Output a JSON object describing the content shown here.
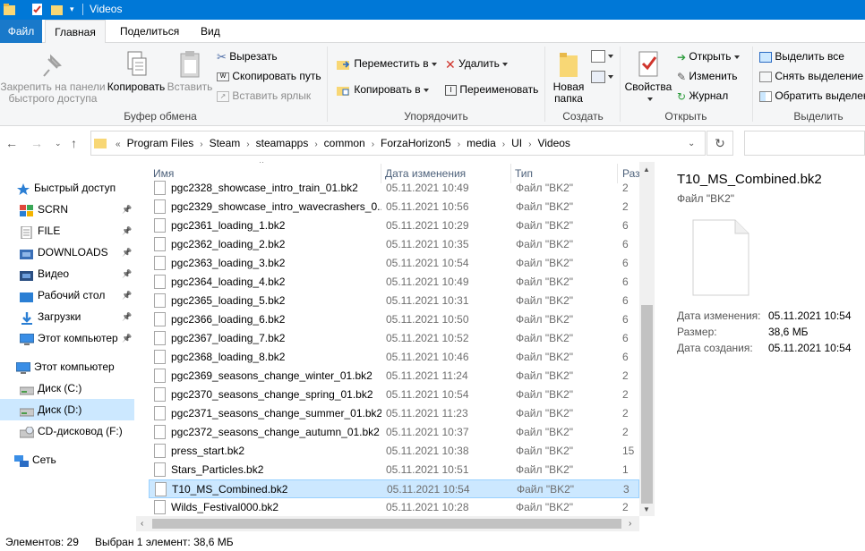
{
  "window": {
    "title": "Videos"
  },
  "ribbon_tabs": {
    "file": "Файл",
    "home": "Главная",
    "share": "Поделиться",
    "view": "Вид"
  },
  "ribbon": {
    "clipboard": {
      "label": "Буфер обмена",
      "pin": "Закрепить на панели быстрого доступа",
      "copy": "Копировать",
      "paste": "Вставить",
      "cut": "Вырезать",
      "copy_path": "Скопировать путь",
      "paste_shortcut": "Вставить ярлык"
    },
    "organize": {
      "label": "Упорядочить",
      "move_to": "Переместить в",
      "copy_to": "Копировать в",
      "delete": "Удалить",
      "rename": "Переименовать"
    },
    "create": {
      "label": "Создать",
      "new_folder": "Новая папка"
    },
    "open": {
      "label": "Открыть",
      "properties": "Свойства",
      "open": "Открыть",
      "edit": "Изменить",
      "history": "Журнал"
    },
    "select": {
      "label": "Выделить",
      "select_all": "Выделить все",
      "select_none": "Снять выделение",
      "invert": "Обратить выделен"
    }
  },
  "address": {
    "prefix": "«",
    "crumbs": [
      "Program Files",
      "Steam",
      "steamapps",
      "common",
      "ForzaHorizon5",
      "media",
      "UI",
      "Videos"
    ]
  },
  "nav_pane": {
    "items": [
      {
        "label": "Быстрый доступ",
        "icon": "star-icon"
      },
      {
        "label": "SCRN",
        "icon": "photos-app-icon",
        "pinned": true
      },
      {
        "label": "FILE",
        "icon": "file-folder-icon",
        "pinned": true
      },
      {
        "label": "DOWNLOADS",
        "icon": "download-folder-icon",
        "pinned": true
      },
      {
        "label": "Видео",
        "icon": "video-folder-icon",
        "pinned": true
      },
      {
        "label": "Рабочий стол",
        "icon": "desktop-folder-icon",
        "pinned": true
      },
      {
        "label": "Загрузки",
        "icon": "downloads-arrow-icon",
        "pinned": true
      },
      {
        "label": "Этот компьютер",
        "icon": "monitor-icon",
        "pinned": true
      },
      {
        "label": "Этот компьютер",
        "icon": "monitor-icon"
      },
      {
        "label": "Диск (C:)",
        "icon": "drive-icon"
      },
      {
        "label": "Диск (D:)",
        "icon": "drive-icon",
        "selected": true
      },
      {
        "label": "CD-дисковод (F:)",
        "icon": "cd-drive-icon"
      },
      {
        "label": "Сеть",
        "icon": "network-icon"
      }
    ]
  },
  "file_list": {
    "columns": {
      "name": "Имя",
      "date": "Дата изменения",
      "type": "Тип",
      "size": "Раз"
    },
    "rows": [
      {
        "name": "pgc2328_showcase_intro_train_01.bk2",
        "date": "05.11.2021 10:49",
        "type": "Файл \"BK2\"",
        "size": "2"
      },
      {
        "name": "pgc2329_showcase_intro_wavecrashers_0...",
        "date": "05.11.2021 10:56",
        "type": "Файл \"BK2\"",
        "size": "2"
      },
      {
        "name": "pgc2361_loading_1.bk2",
        "date": "05.11.2021 10:29",
        "type": "Файл \"BK2\"",
        "size": "6"
      },
      {
        "name": "pgc2362_loading_2.bk2",
        "date": "05.11.2021 10:35",
        "type": "Файл \"BK2\"",
        "size": "6"
      },
      {
        "name": "pgc2363_loading_3.bk2",
        "date": "05.11.2021 10:54",
        "type": "Файл \"BK2\"",
        "size": "6"
      },
      {
        "name": "pgc2364_loading_4.bk2",
        "date": "05.11.2021 10:49",
        "type": "Файл \"BK2\"",
        "size": "6"
      },
      {
        "name": "pgc2365_loading_5.bk2",
        "date": "05.11.2021 10:31",
        "type": "Файл \"BK2\"",
        "size": "6"
      },
      {
        "name": "pgc2366_loading_6.bk2",
        "date": "05.11.2021 10:50",
        "type": "Файл \"BK2\"",
        "size": "6"
      },
      {
        "name": "pgc2367_loading_7.bk2",
        "date": "05.11.2021 10:52",
        "type": "Файл \"BK2\"",
        "size": "6"
      },
      {
        "name": "pgc2368_loading_8.bk2",
        "date": "05.11.2021 10:46",
        "type": "Файл \"BK2\"",
        "size": "6"
      },
      {
        "name": "pgc2369_seasons_change_winter_01.bk2",
        "date": "05.11.2021 11:24",
        "type": "Файл \"BK2\"",
        "size": "2"
      },
      {
        "name": "pgc2370_seasons_change_spring_01.bk2",
        "date": "05.11.2021 10:54",
        "type": "Файл \"BK2\"",
        "size": "2"
      },
      {
        "name": "pgc2371_seasons_change_summer_01.bk2",
        "date": "05.11.2021 11:23",
        "type": "Файл \"BK2\"",
        "size": "2"
      },
      {
        "name": "pgc2372_seasons_change_autumn_01.bk2",
        "date": "05.11.2021 10:37",
        "type": "Файл \"BK2\"",
        "size": "2"
      },
      {
        "name": "press_start.bk2",
        "date": "05.11.2021 10:38",
        "type": "Файл \"BK2\"",
        "size": "15"
      },
      {
        "name": "Stars_Particles.bk2",
        "date": "05.11.2021 10:51",
        "type": "Файл \"BK2\"",
        "size": "1"
      },
      {
        "name": "T10_MS_Combined.bk2",
        "date": "05.11.2021 10:54",
        "type": "Файл \"BK2\"",
        "size": "3",
        "selected": true
      },
      {
        "name": "Wilds_Festival000.bk2",
        "date": "05.11.2021 10:28",
        "type": "Файл \"BK2\"",
        "size": "2"
      }
    ]
  },
  "preview": {
    "title": "T10_MS_Combined.bk2",
    "type": "Файл \"BK2\"",
    "props": [
      {
        "key": "Дата изменения:",
        "value": "05.11.2021 10:54"
      },
      {
        "key": "Размер:",
        "value": "38,6 МБ"
      },
      {
        "key": "Дата создания:",
        "value": "05.11.2021 10:54"
      }
    ]
  },
  "status": {
    "count": "Элементов: 29",
    "selected": "Выбран 1 элемент: 38,6 МБ"
  },
  "colors": {
    "accent": "#0078d7",
    "selection": "#cce8ff",
    "folder": "#f8d775"
  }
}
